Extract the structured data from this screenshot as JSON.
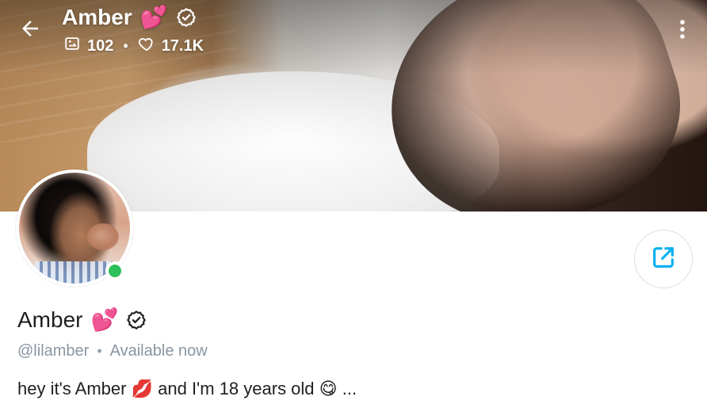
{
  "header": {
    "title": "Amber",
    "title_emoji": "💕",
    "stats": {
      "photos": "102",
      "likes": "17.1K",
      "separator": "•"
    }
  },
  "profile": {
    "name": "Amber",
    "name_emoji": "💕",
    "handle": "@lilamber",
    "meta_separator": "•",
    "availability": "Available now",
    "bio_parts": {
      "part1": "hey it's Amber ",
      "emoji1": "💋",
      "part2": " and I'm 18 years old ",
      "emoji2": "😋",
      "ellipsis": " ..."
    }
  },
  "icons": {
    "back": "arrow-left-icon",
    "more": "vertical-dots-icon",
    "verified": "verified-badge-icon",
    "photos": "image-icon",
    "likes": "heart-outline-icon",
    "share": "share-external-icon",
    "online": "online-status-dot"
  },
  "colors": {
    "brand_accent": "#00aff0",
    "online_green": "#2dbf5a",
    "muted_text": "#8a96a3",
    "primary_text": "#1f1f1f",
    "border": "#d9dde3"
  }
}
